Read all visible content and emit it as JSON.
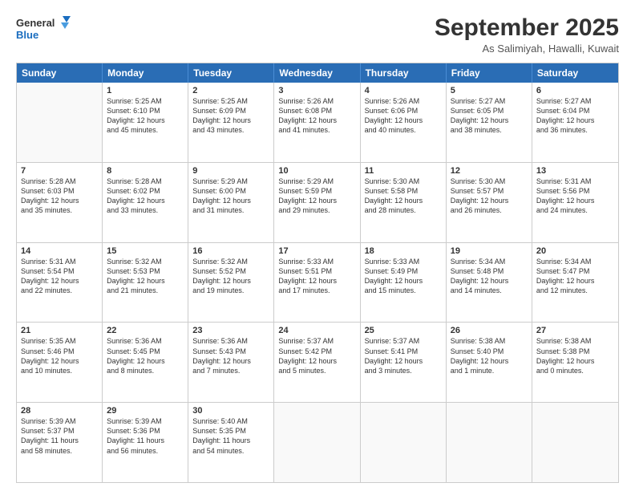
{
  "logo": {
    "line1": "General",
    "line2": "Blue"
  },
  "title": "September 2025",
  "location": "As Salimiyah, Hawalli, Kuwait",
  "days_header": [
    "Sunday",
    "Monday",
    "Tuesday",
    "Wednesday",
    "Thursday",
    "Friday",
    "Saturday"
  ],
  "weeks": [
    [
      {
        "day": "",
        "info": ""
      },
      {
        "day": "1",
        "info": "Sunrise: 5:25 AM\nSunset: 6:10 PM\nDaylight: 12 hours\nand 45 minutes."
      },
      {
        "day": "2",
        "info": "Sunrise: 5:25 AM\nSunset: 6:09 PM\nDaylight: 12 hours\nand 43 minutes."
      },
      {
        "day": "3",
        "info": "Sunrise: 5:26 AM\nSunset: 6:08 PM\nDaylight: 12 hours\nand 41 minutes."
      },
      {
        "day": "4",
        "info": "Sunrise: 5:26 AM\nSunset: 6:06 PM\nDaylight: 12 hours\nand 40 minutes."
      },
      {
        "day": "5",
        "info": "Sunrise: 5:27 AM\nSunset: 6:05 PM\nDaylight: 12 hours\nand 38 minutes."
      },
      {
        "day": "6",
        "info": "Sunrise: 5:27 AM\nSunset: 6:04 PM\nDaylight: 12 hours\nand 36 minutes."
      }
    ],
    [
      {
        "day": "7",
        "info": "Sunrise: 5:28 AM\nSunset: 6:03 PM\nDaylight: 12 hours\nand 35 minutes."
      },
      {
        "day": "8",
        "info": "Sunrise: 5:28 AM\nSunset: 6:02 PM\nDaylight: 12 hours\nand 33 minutes."
      },
      {
        "day": "9",
        "info": "Sunrise: 5:29 AM\nSunset: 6:00 PM\nDaylight: 12 hours\nand 31 minutes."
      },
      {
        "day": "10",
        "info": "Sunrise: 5:29 AM\nSunset: 5:59 PM\nDaylight: 12 hours\nand 29 minutes."
      },
      {
        "day": "11",
        "info": "Sunrise: 5:30 AM\nSunset: 5:58 PM\nDaylight: 12 hours\nand 28 minutes."
      },
      {
        "day": "12",
        "info": "Sunrise: 5:30 AM\nSunset: 5:57 PM\nDaylight: 12 hours\nand 26 minutes."
      },
      {
        "day": "13",
        "info": "Sunrise: 5:31 AM\nSunset: 5:56 PM\nDaylight: 12 hours\nand 24 minutes."
      }
    ],
    [
      {
        "day": "14",
        "info": "Sunrise: 5:31 AM\nSunset: 5:54 PM\nDaylight: 12 hours\nand 22 minutes."
      },
      {
        "day": "15",
        "info": "Sunrise: 5:32 AM\nSunset: 5:53 PM\nDaylight: 12 hours\nand 21 minutes."
      },
      {
        "day": "16",
        "info": "Sunrise: 5:32 AM\nSunset: 5:52 PM\nDaylight: 12 hours\nand 19 minutes."
      },
      {
        "day": "17",
        "info": "Sunrise: 5:33 AM\nSunset: 5:51 PM\nDaylight: 12 hours\nand 17 minutes."
      },
      {
        "day": "18",
        "info": "Sunrise: 5:33 AM\nSunset: 5:49 PM\nDaylight: 12 hours\nand 15 minutes."
      },
      {
        "day": "19",
        "info": "Sunrise: 5:34 AM\nSunset: 5:48 PM\nDaylight: 12 hours\nand 14 minutes."
      },
      {
        "day": "20",
        "info": "Sunrise: 5:34 AM\nSunset: 5:47 PM\nDaylight: 12 hours\nand 12 minutes."
      }
    ],
    [
      {
        "day": "21",
        "info": "Sunrise: 5:35 AM\nSunset: 5:46 PM\nDaylight: 12 hours\nand 10 minutes."
      },
      {
        "day": "22",
        "info": "Sunrise: 5:36 AM\nSunset: 5:45 PM\nDaylight: 12 hours\nand 8 minutes."
      },
      {
        "day": "23",
        "info": "Sunrise: 5:36 AM\nSunset: 5:43 PM\nDaylight: 12 hours\nand 7 minutes."
      },
      {
        "day": "24",
        "info": "Sunrise: 5:37 AM\nSunset: 5:42 PM\nDaylight: 12 hours\nand 5 minutes."
      },
      {
        "day": "25",
        "info": "Sunrise: 5:37 AM\nSunset: 5:41 PM\nDaylight: 12 hours\nand 3 minutes."
      },
      {
        "day": "26",
        "info": "Sunrise: 5:38 AM\nSunset: 5:40 PM\nDaylight: 12 hours\nand 1 minute."
      },
      {
        "day": "27",
        "info": "Sunrise: 5:38 AM\nSunset: 5:38 PM\nDaylight: 12 hours\nand 0 minutes."
      }
    ],
    [
      {
        "day": "28",
        "info": "Sunrise: 5:39 AM\nSunset: 5:37 PM\nDaylight: 11 hours\nand 58 minutes."
      },
      {
        "day": "29",
        "info": "Sunrise: 5:39 AM\nSunset: 5:36 PM\nDaylight: 11 hours\nand 56 minutes."
      },
      {
        "day": "30",
        "info": "Sunrise: 5:40 AM\nSunset: 5:35 PM\nDaylight: 11 hours\nand 54 minutes."
      },
      {
        "day": "",
        "info": ""
      },
      {
        "day": "",
        "info": ""
      },
      {
        "day": "",
        "info": ""
      },
      {
        "day": "",
        "info": ""
      }
    ]
  ]
}
